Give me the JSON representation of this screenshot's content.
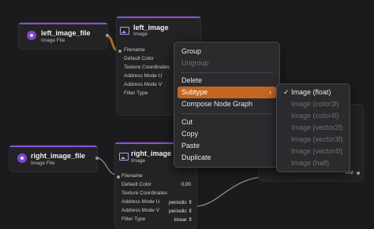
{
  "colors": {
    "accent_purple": "#8a4fd6",
    "menu_highlight": "#c4661f",
    "background": "#1b1b1d"
  },
  "nodes": {
    "left_file": {
      "title": "left_image_file",
      "subtitle": "Image File",
      "icon": "file-circle-icon"
    },
    "left_image": {
      "title": "left_image",
      "subtitle": "Image",
      "icon": "image-icon",
      "ports": [
        "Filename",
        "Default Color",
        "Texture Coordinates",
        "Address Mode U",
        "Address Mode V",
        "Filter Type"
      ]
    },
    "right_file": {
      "title": "right_image_file",
      "subtitle": "Image File",
      "icon": "file-circle-icon"
    },
    "right_image": {
      "title": "right_image",
      "subtitle": "Image",
      "icon": "image-icon",
      "ports": [
        "Filename",
        "Default Color",
        "Texture Coordinates",
        "Address Mode U",
        "Address Mode V",
        "Filter Type"
      ],
      "values": {
        "default_color": "0,00",
        "address_u": "periodic",
        "address_v": "periodic",
        "filter": "linear"
      }
    },
    "far_node": {
      "out_label": "Out"
    }
  },
  "context_menu": {
    "items": [
      {
        "label": "Group",
        "disabled": false
      },
      {
        "label": "Ungroup",
        "disabled": true
      },
      {
        "label": "Delete",
        "disabled": false
      },
      {
        "label": "Subtype",
        "disabled": false,
        "highlighted": true,
        "submenu": true
      },
      {
        "label": "Compose Node Graph",
        "disabled": false
      },
      {
        "label": "Cut",
        "disabled": false
      },
      {
        "label": "Copy",
        "disabled": false
      },
      {
        "label": "Paste",
        "disabled": false
      },
      {
        "label": "Duplicate",
        "disabled": false
      }
    ]
  },
  "submenu": {
    "items": [
      {
        "label": "Image (float)",
        "checked": true,
        "disabled": false
      },
      {
        "label": "Image (color3f)",
        "disabled": true
      },
      {
        "label": "Image (color4f)",
        "disabled": true
      },
      {
        "label": "Image (vector2f)",
        "disabled": true
      },
      {
        "label": "Image (vector3f)",
        "disabled": true
      },
      {
        "label": "Image (vector4f)",
        "disabled": true
      },
      {
        "label": "Image (half)",
        "disabled": true
      }
    ],
    "check_glyph": "✓"
  }
}
